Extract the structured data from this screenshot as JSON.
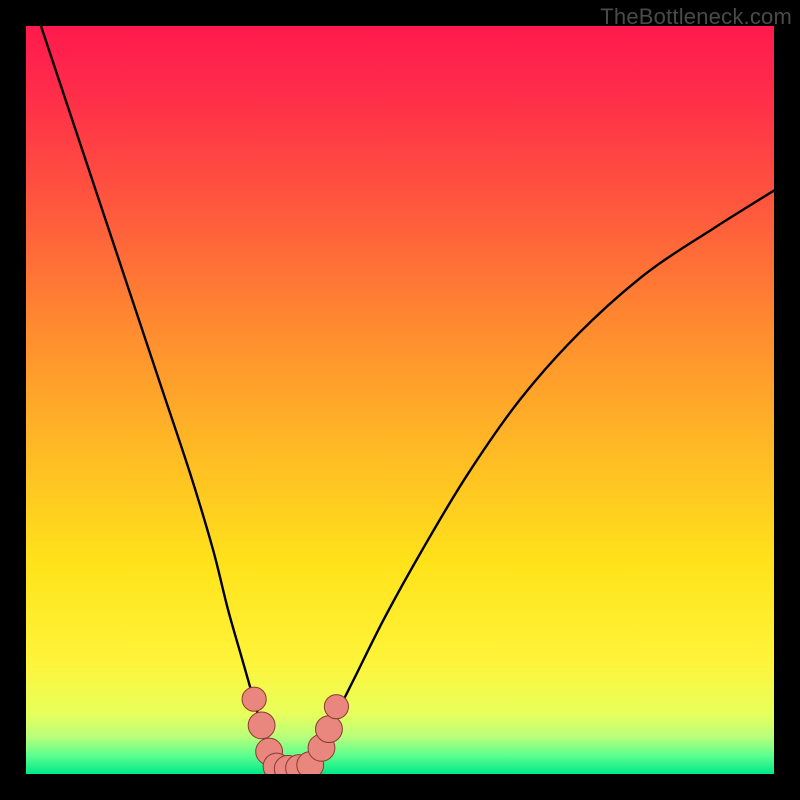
{
  "watermark": "TheBottleneck.com",
  "chart_data": {
    "type": "line",
    "title": "",
    "xlabel": "",
    "ylabel": "",
    "xlim": [
      0,
      100
    ],
    "ylim": [
      0,
      100
    ],
    "series": [
      {
        "name": "bottleneck-curve",
        "x": [
          2,
          6,
          10,
          14,
          18,
          22,
          25,
          27,
          29,
          31,
          32.5,
          34,
          35.5,
          37,
          39,
          41,
          44,
          48,
          53,
          59,
          66,
          74,
          83,
          92,
          100
        ],
        "values": [
          100,
          88,
          76,
          64,
          52,
          40,
          30,
          22,
          15,
          8,
          3,
          0.8,
          0.5,
          0.8,
          3,
          7,
          13,
          21,
          30,
          40,
          50,
          59,
          67,
          73,
          78
        ]
      }
    ],
    "markers": [
      {
        "name": "left-cluster-top",
        "x": 30.5,
        "y": 10.0,
        "r": 1.2
      },
      {
        "name": "left-cluster-mid",
        "x": 31.5,
        "y": 6.5,
        "r": 1.4
      },
      {
        "name": "left-cluster-low",
        "x": 32.5,
        "y": 3.0,
        "r": 1.4
      },
      {
        "name": "valley-1",
        "x": 33.5,
        "y": 1.0,
        "r": 1.4
      },
      {
        "name": "valley-2",
        "x": 35.0,
        "y": 0.7,
        "r": 1.4
      },
      {
        "name": "valley-3",
        "x": 36.5,
        "y": 0.8,
        "r": 1.4
      },
      {
        "name": "valley-4",
        "x": 38.0,
        "y": 1.2,
        "r": 1.4
      },
      {
        "name": "right-cluster-low",
        "x": 39.5,
        "y": 3.5,
        "r": 1.4
      },
      {
        "name": "right-cluster-mid",
        "x": 40.5,
        "y": 6.0,
        "r": 1.4
      },
      {
        "name": "right-cluster-top",
        "x": 41.5,
        "y": 9.0,
        "r": 1.2
      }
    ],
    "colors": {
      "curve": "#000000",
      "marker_fill": "#e9867d",
      "marker_stroke": "#8a3a33"
    }
  }
}
